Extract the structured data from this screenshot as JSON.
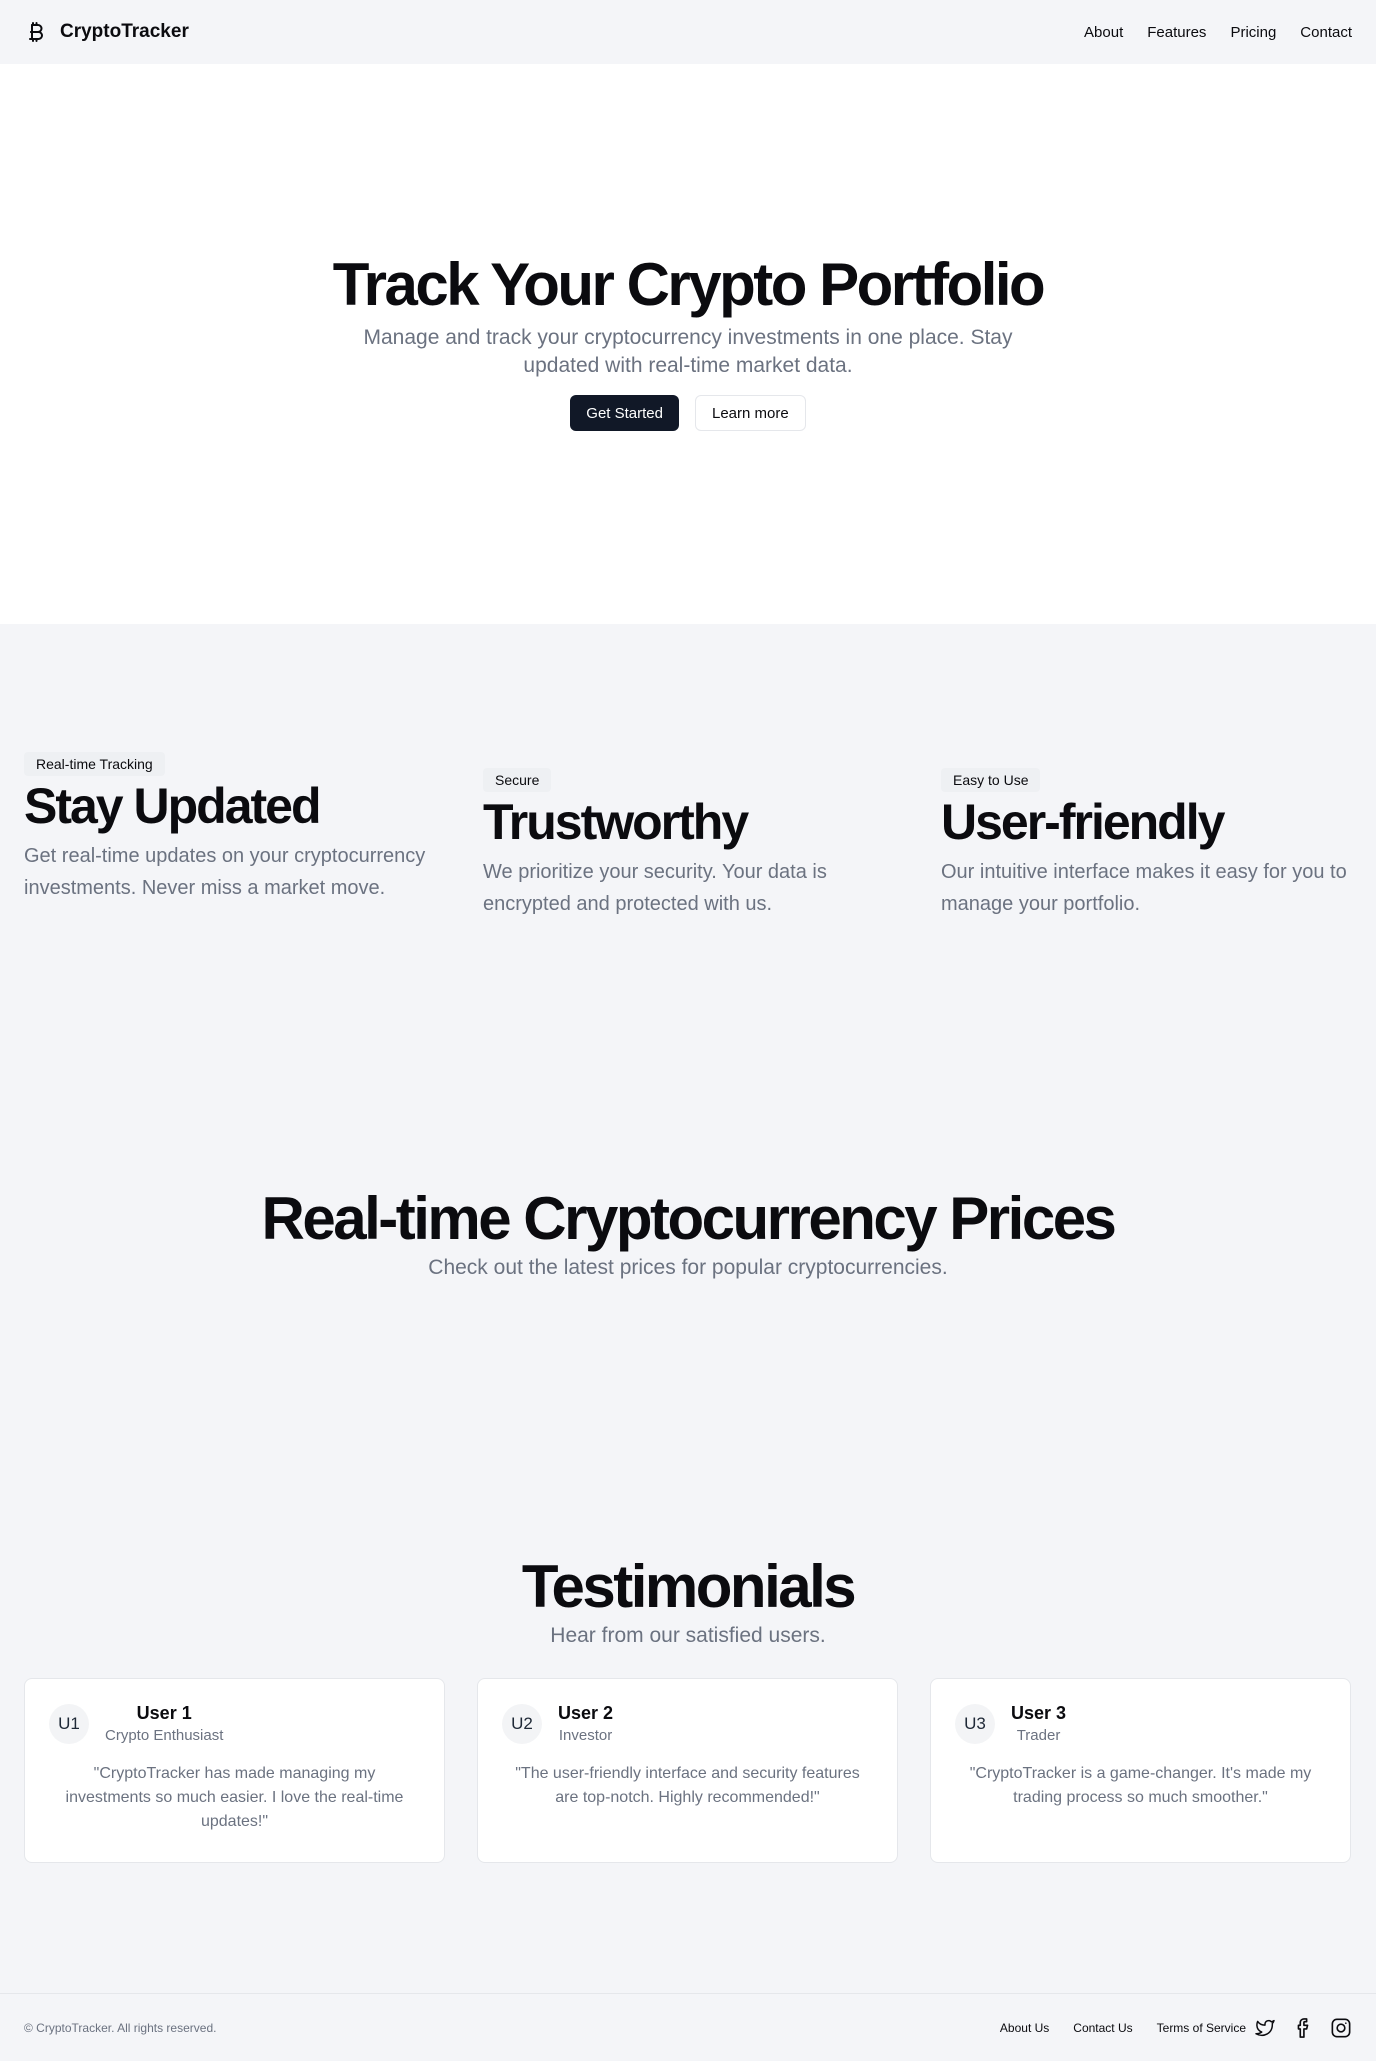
{
  "header": {
    "brand": "CryptoTracker",
    "brand_icon": "bitcoin-icon",
    "nav": [
      "About",
      "Features",
      "Pricing",
      "Contact"
    ]
  },
  "hero": {
    "title": "Track Your Crypto Portfolio",
    "subtitle": "Manage and track your cryptocurrency investments in one place. Stay updated with real-time market data.",
    "primary_button": "Get Started",
    "secondary_button": "Learn more"
  },
  "features": [
    {
      "badge": "Real-time Tracking",
      "title": "Stay Updated",
      "text": "Get real-time updates on your cryptocurrency investments. Never miss a market move."
    },
    {
      "badge": "Secure",
      "title": "Trustworthy",
      "text": "We prioritize your security. Your data is encrypted and protected with us."
    },
    {
      "badge": "Easy to Use",
      "title": "User-friendly",
      "text": "Our intuitive interface makes it easy for you to manage your portfolio."
    }
  ],
  "prices": {
    "title": "Real-time Cryptocurrency Prices",
    "subtitle": "Check out the latest prices for popular cryptocurrencies."
  },
  "testimonials": {
    "title": "Testimonials",
    "subtitle": "Hear from our satisfied users.",
    "items": [
      {
        "initials": "U1",
        "name": "User 1",
        "role": "Crypto Enthusiast",
        "quote": "\"CryptoTracker has made managing my investments so much easier. I love the real-time updates!\""
      },
      {
        "initials": "U2",
        "name": "User 2",
        "role": "Investor",
        "quote": "\"The user-friendly interface and security features are top-notch. Highly recommended!\""
      },
      {
        "initials": "U3",
        "name": "User 3",
        "role": "Trader",
        "quote": "\"CryptoTracker is a game-changer. It's made my trading process so much smoother.\""
      }
    ]
  },
  "footer": {
    "copyright": "© CryptoTracker. All rights reserved.",
    "links": [
      "About Us",
      "Contact Us",
      "Terms of Service"
    ],
    "social_icons": [
      "twitter-icon",
      "facebook-icon",
      "instagram-icon"
    ]
  },
  "colors": {
    "page_bg": "#f4f5f8",
    "hero_bg": "#ffffff",
    "primary_button": "#111827",
    "muted_text": "#6b7280"
  }
}
